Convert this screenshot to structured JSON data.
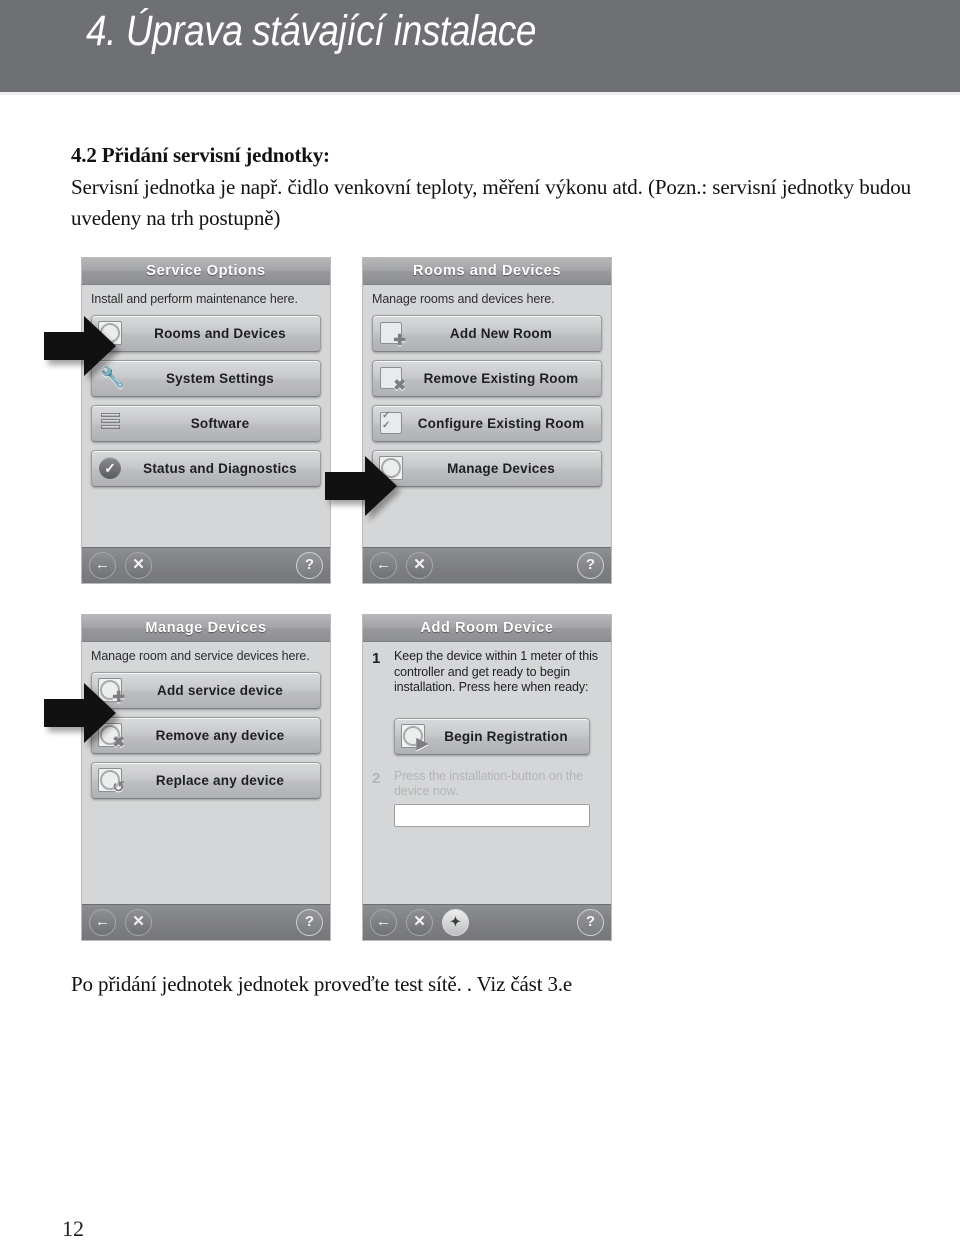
{
  "header": {
    "title": "4. Úprava stávající instalace",
    "bg_color": "#6f7074",
    "text_color": "#ffffff"
  },
  "content": {
    "sub_heading": "4.2 Přidání servisní jednotky:",
    "paragraph": "Servisní jednotka je např. čidlo venkovní teploty, měření výkonu atd. (Pozn.: servisní jednotky budou uvedeny na trh postupně)",
    "caption": "Po přidání jednotek jednotek proveďte test sítě. . Viz část 3.e"
  },
  "page_number": "12",
  "panels": [
    {
      "id": "service-options",
      "title": "Service Options",
      "subtitle": "Install and perform maintenance here.",
      "buttons": [
        {
          "label": "Rooms and Devices",
          "icon": "rooms-devices-icon"
        },
        {
          "label": "System Settings",
          "icon": "wrench-icon"
        },
        {
          "label": "Software",
          "icon": "disk-stack-icon"
        },
        {
          "label": "Status and Diagnostics",
          "icon": "check-circle-icon"
        }
      ],
      "footer": [
        {
          "name": "back-icon",
          "glyph": "←"
        },
        {
          "name": "close-icon",
          "glyph": "✕"
        },
        {
          "name": "help-icon",
          "glyph": "?"
        }
      ]
    },
    {
      "id": "rooms-and-devices",
      "title": "Rooms and Devices",
      "subtitle": "Manage rooms and devices here.",
      "buttons": [
        {
          "label": "Add New Room",
          "icon": "add-room-icon"
        },
        {
          "label": "Remove Existing Room",
          "icon": "remove-room-icon"
        },
        {
          "label": "Configure Existing Room",
          "icon": "configure-room-icon"
        },
        {
          "label": "Manage Devices",
          "icon": "manage-devices-icon"
        }
      ],
      "footer": [
        {
          "name": "back-icon",
          "glyph": "←"
        },
        {
          "name": "close-icon",
          "glyph": "✕"
        },
        {
          "name": "help-icon",
          "glyph": "?"
        }
      ]
    },
    {
      "id": "manage-devices",
      "title": "Manage Devices",
      "subtitle": "Manage room and service devices here.",
      "buttons": [
        {
          "label": "Add service device",
          "icon": "add-device-icon"
        },
        {
          "label": "Remove any device",
          "icon": "remove-device-icon"
        },
        {
          "label": "Replace any device",
          "icon": "replace-device-icon"
        }
      ],
      "footer": [
        {
          "name": "back-icon",
          "glyph": "←"
        },
        {
          "name": "close-icon",
          "glyph": "✕"
        },
        {
          "name": "help-icon",
          "glyph": "?"
        }
      ]
    },
    {
      "id": "add-room-device",
      "title": "Add Room Device",
      "steps": [
        {
          "number": "1",
          "text": "Keep the device within 1 meter of this controller and get ready to begin installation. Press here when ready:",
          "disabled": false
        },
        {
          "number": "2",
          "text": "Press the installation-button on the device now.",
          "disabled": true
        }
      ],
      "action_button": {
        "label": "Begin Registration",
        "icon": "begin-registration-icon"
      },
      "input_value": "",
      "footer": [
        {
          "name": "back-icon",
          "glyph": "←"
        },
        {
          "name": "close-icon",
          "glyph": "✕"
        },
        {
          "name": "wand-icon",
          "glyph": "✦"
        },
        {
          "name": "help-icon",
          "glyph": "?"
        }
      ]
    }
  ],
  "arrows": [
    {
      "name": "arrow-rooms-and-devices",
      "points_to": "Rooms and Devices"
    },
    {
      "name": "arrow-manage-devices",
      "points_to": "Manage Devices"
    },
    {
      "name": "arrow-add-service-device",
      "points_to": "Add service device"
    }
  ]
}
